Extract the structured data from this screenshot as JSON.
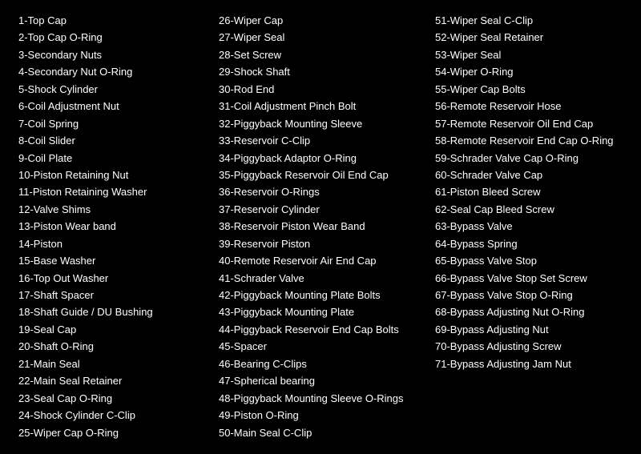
{
  "columns": [
    {
      "id": "col1",
      "items": [
        "1-Top Cap",
        "2-Top Cap O-Ring",
        "3-Secondary Nuts",
        "4-Secondary Nut O-Ring",
        "5-Shock Cylinder",
        "6-Coil Adjustment Nut",
        "7-Coil Spring",
        "8-Coil Slider",
        "9-Coil Plate",
        "10-Piston Retaining Nut",
        "11-Piston Retaining Washer",
        "12-Valve Shims",
        "13-Piston Wear band",
        "14-Piston",
        "15-Base Washer",
        "16-Top Out Washer",
        "17-Shaft Spacer",
        "18-Shaft Guide / DU Bushing",
        "19-Seal Cap",
        "20-Shaft O-Ring",
        "21-Main Seal",
        "22-Main Seal Retainer",
        "23-Seal Cap O-Ring",
        "24-Shock Cylinder C-Clip",
        "25-Wiper Cap O-Ring"
      ]
    },
    {
      "id": "col2",
      "items": [
        "26-Wiper Cap",
        "27-Wiper Seal",
        "28-Set Screw",
        "29-Shock Shaft",
        "30-Rod End",
        "31-Coil Adjustment Pinch Bolt",
        "32-Piggyback Mounting Sleeve",
        "33-Reservoir C-Clip",
        "34-Piggyback Adaptor O-Ring",
        "35-Piggyback Reservoir Oil End Cap",
        "36-Reservoir O-Rings",
        "37-Reservoir Cylinder",
        "38-Reservoir Piston Wear Band",
        "39-Reservoir Piston",
        "40-Remote Reservoir Air End Cap",
        "41-Schrader Valve",
        "42-Piggyback Mounting Plate Bolts",
        "43-Piggyback Mounting Plate",
        "44-Piggyback Reservoir End Cap Bolts",
        "45-Spacer",
        "46-Bearing C-Clips",
        "47-Spherical bearing",
        "48-Piggyback Mounting Sleeve O-Rings",
        "49-Piston O-Ring",
        "50-Main Seal C-Clip"
      ]
    },
    {
      "id": "col3",
      "items": [
        "51-Wiper Seal C-Clip",
        "52-Wiper Seal Retainer",
        "53-Wiper Seal",
        "54-Wiper O-Ring",
        "55-Wiper Cap Bolts",
        "56-Remote Reservoir Hose",
        "57-Remote Reservoir Oil End Cap",
        "58-Remote Reservoir End Cap O-Ring",
        "59-Schrader Valve Cap O-Ring",
        "60-Schrader Valve Cap",
        "61-Piston Bleed Screw",
        "62-Seal Cap Bleed Screw",
        "63-Bypass Valve",
        "64-Bypass Spring",
        "65-Bypass Valve Stop",
        "66-Bypass Valve Stop Set Screw",
        "67-Bypass Valve Stop O-Ring",
        "68-Bypass Adjusting Nut O-Ring",
        "69-Bypass Adjusting Nut",
        "70-Bypass Adjusting Screw",
        "71-Bypass Adjusting Jam Nut"
      ]
    }
  ]
}
